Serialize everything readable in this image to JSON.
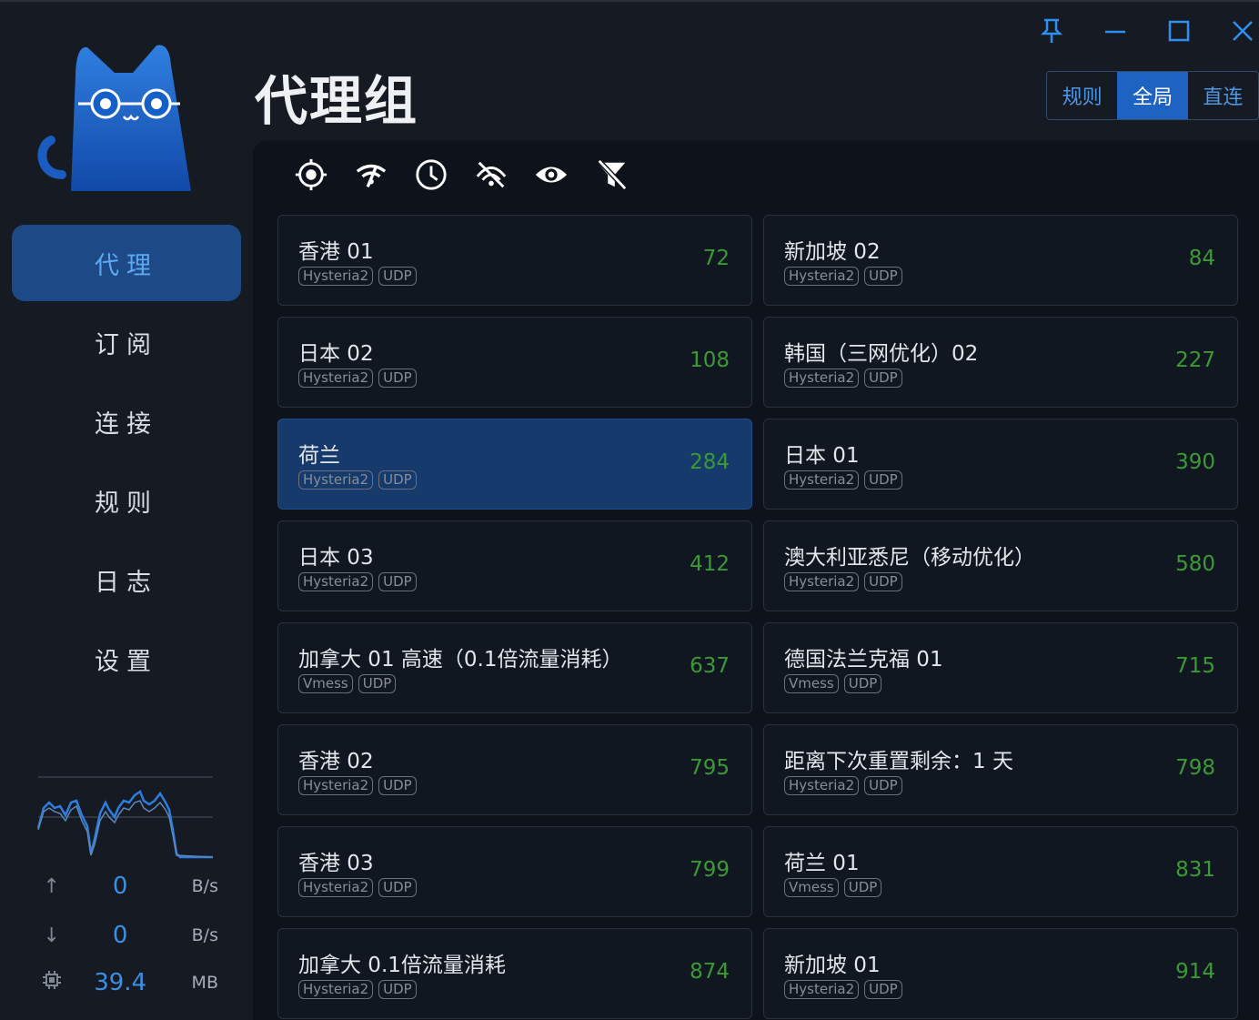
{
  "title": "代理组",
  "nav": [
    {
      "label": "代理",
      "active": true
    },
    {
      "label": "订阅",
      "active": false
    },
    {
      "label": "连接",
      "active": false
    },
    {
      "label": "规则",
      "active": false
    },
    {
      "label": "日志",
      "active": false
    },
    {
      "label": "设置",
      "active": false
    }
  ],
  "traffic": {
    "upload_value": "0",
    "upload_unit": "B/s",
    "download_value": "0",
    "download_unit": "B/s",
    "memory_value": "39.4",
    "memory_unit": "MB"
  },
  "modes": [
    {
      "label": "规则",
      "active": false
    },
    {
      "label": "全局",
      "active": true
    },
    {
      "label": "直连",
      "active": false
    }
  ],
  "toolbar_icons": [
    "locate-icon",
    "signal-test-icon",
    "clock-sort-icon",
    "hide-unavailable-icon",
    "eye-icon",
    "filter-off-icon"
  ],
  "window_icons": [
    "pin-icon",
    "minimize-icon",
    "maximize-icon",
    "close-icon"
  ],
  "proxies": [
    {
      "name": "香港 01",
      "tags": [
        "Hysteria2",
        "UDP"
      ],
      "latency": "72",
      "selected": false
    },
    {
      "name": "新加坡 02",
      "tags": [
        "Hysteria2",
        "UDP"
      ],
      "latency": "84",
      "selected": false
    },
    {
      "name": "日本 02",
      "tags": [
        "Hysteria2",
        "UDP"
      ],
      "latency": "108",
      "selected": false
    },
    {
      "name": "韩国（三网优化）02",
      "tags": [
        "Hysteria2",
        "UDP"
      ],
      "latency": "227",
      "selected": false
    },
    {
      "name": "荷兰",
      "tags": [
        "Hysteria2",
        "UDP"
      ],
      "latency": "284",
      "selected": true
    },
    {
      "name": "日本 01",
      "tags": [
        "Hysteria2",
        "UDP"
      ],
      "latency": "390",
      "selected": false
    },
    {
      "name": "日本 03",
      "tags": [
        "Hysteria2",
        "UDP"
      ],
      "latency": "412",
      "selected": false
    },
    {
      "name": "澳大利亚悉尼（移动优化）",
      "tags": [
        "Hysteria2",
        "UDP"
      ],
      "latency": "580",
      "selected": false
    },
    {
      "name": "加拿大 01 高速（0.1倍流量消耗）",
      "tags": [
        "Vmess",
        "UDP"
      ],
      "latency": "637",
      "selected": false
    },
    {
      "name": "德国法兰克福 01",
      "tags": [
        "Vmess",
        "UDP"
      ],
      "latency": "715",
      "selected": false
    },
    {
      "name": "香港 02",
      "tags": [
        "Hysteria2",
        "UDP"
      ],
      "latency": "795",
      "selected": false
    },
    {
      "name": "距离下次重置剩余：1 天",
      "tags": [
        "Hysteria2",
        "UDP"
      ],
      "latency": "798",
      "selected": false
    },
    {
      "name": "香港 03",
      "tags": [
        "Hysteria2",
        "UDP"
      ],
      "latency": "799",
      "selected": false
    },
    {
      "name": "荷兰 01",
      "tags": [
        "Vmess",
        "UDP"
      ],
      "latency": "831",
      "selected": false
    },
    {
      "name": "加拿大 0.1倍流量消耗",
      "tags": [
        "Hysteria2",
        "UDP"
      ],
      "latency": "874",
      "selected": false
    },
    {
      "name": "新加坡 01",
      "tags": [
        "Hysteria2",
        "UDP"
      ],
      "latency": "914",
      "selected": false
    }
  ],
  "colors": {
    "accent": "#1e63c2",
    "nav_active_bg": "#1d4a86",
    "latency_green": "#3a9a36",
    "panel_bg": "#0d121b"
  }
}
